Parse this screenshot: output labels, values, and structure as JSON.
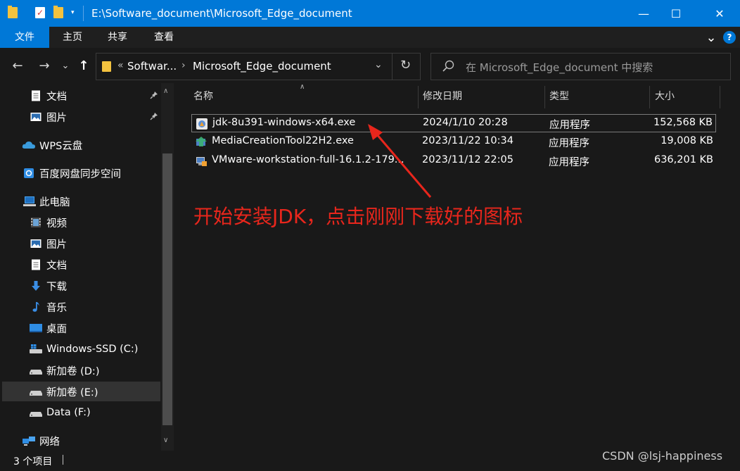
{
  "window": {
    "title": "E:\\Software_document\\Microsoft_Edge_document",
    "quick_access_arrow": "▾",
    "minimize": "—",
    "maximize": "☐",
    "close": "✕"
  },
  "ribbon": {
    "tabs": [
      {
        "label": "文件",
        "active": true
      },
      {
        "label": "主页"
      },
      {
        "label": "共享"
      },
      {
        "label": "查看"
      }
    ],
    "expand": "⌄",
    "help": "?"
  },
  "nav": {
    "back": "←",
    "forward": "→",
    "recent": "⌄",
    "up": "↑",
    "address": {
      "overflow": "«",
      "segments": [
        "Softwar...",
        "Microsoft_Edge_document"
      ],
      "separator": "›",
      "dropdown": "⌄",
      "refresh": "↻"
    },
    "search_placeholder": "在 Microsoft_Edge_document 中搜索"
  },
  "sidebar": {
    "items": [
      {
        "label": "文档",
        "icon": "document-icon",
        "pinned": true
      },
      {
        "label": "图片",
        "icon": "picture-icon",
        "pinned": true
      },
      {
        "label": "WPS云盘",
        "icon": "cloud-icon"
      },
      {
        "label": "百度网盘同步空间",
        "icon": "baidu-disk-icon"
      },
      {
        "label": "此电脑",
        "icon": "this-pc-icon"
      },
      {
        "label": "视频",
        "icon": "video-icon"
      },
      {
        "label": "图片",
        "icon": "picture-icon"
      },
      {
        "label": "文档",
        "icon": "document-icon"
      },
      {
        "label": "下载",
        "icon": "download-icon"
      },
      {
        "label": "音乐",
        "icon": "music-icon"
      },
      {
        "label": "桌面",
        "icon": "desktop-icon"
      },
      {
        "label": "Windows-SSD (C:)",
        "icon": "windows-drive-icon"
      },
      {
        "label": "新加卷 (D:)",
        "icon": "drive-icon"
      },
      {
        "label": "新加卷 (E:)",
        "icon": "drive-icon",
        "selected": true
      },
      {
        "label": "Data (F:)",
        "icon": "drive-icon"
      },
      {
        "label": "网络",
        "icon": "network-icon"
      }
    ],
    "pin_glyph": "📌",
    "scroll_up": "∧",
    "scroll_down": "∨"
  },
  "filelist": {
    "sort_indicator": "∧",
    "columns": [
      "名称",
      "修改日期",
      "类型",
      "大小"
    ],
    "rows": [
      {
        "name": "jdk-8u391-windows-x64.exe",
        "modified": "2024/1/10 20:28",
        "type": "应用程序",
        "size": "152,568 KB",
        "icon": "installer-icon",
        "focused": true
      },
      {
        "name": "MediaCreationTool22H2.exe",
        "modified": "2023/11/22 10:34",
        "type": "应用程序",
        "size": "19,008 KB",
        "icon": "media-creation-icon"
      },
      {
        "name": "VMware-workstation-full-16.1.2-179...",
        "modified": "2023/11/12 22:05",
        "type": "应用程序",
        "size": "636,201 KB",
        "icon": "vmware-icon"
      }
    ]
  },
  "annotation": {
    "text": "开始安装JDK，点击刚刚下载好的图标",
    "color": "#e8261c"
  },
  "status": {
    "item_count": "3 个项目"
  },
  "watermark": "CSDN @lsj-happiness"
}
